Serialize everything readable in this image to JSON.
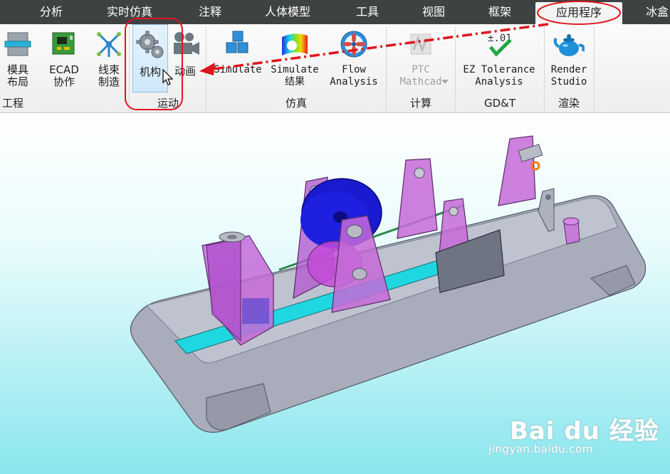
{
  "menu": {
    "tabs": [
      {
        "label": "分析",
        "active": false
      },
      {
        "label": "实时仿真",
        "active": false
      },
      {
        "label": "注释",
        "active": false
      },
      {
        "label": "人体模型",
        "active": false
      },
      {
        "label": "工具",
        "active": false
      },
      {
        "label": "视图",
        "active": false
      },
      {
        "label": "框架",
        "active": false
      },
      {
        "label": "应用程序",
        "active": true
      },
      {
        "label": "冰盒",
        "active": false
      }
    ]
  },
  "ribbon": {
    "buttons": {
      "mold_layout": "模具\n布局",
      "ecad_collab": "ECAD\n协作",
      "harness_mfg": "线束\n制造",
      "mechanism": "机构",
      "animation": "动画",
      "simulate": "Simulate",
      "simulate_results": "Simulate\n结果",
      "flow_analysis": "Flow\nAnalysis",
      "ptc_mathcad": "PTC\nMathcad",
      "ez_tolerance": "EZ Tolerance\nAnalysis",
      "render_studio": "Render\nStudio"
    },
    "groups": {
      "engineering": "工程",
      "motion": "运动",
      "simulation": "仿真",
      "calculation": "计算",
      "gdt": "GD&T",
      "render": "渲染"
    },
    "ez_icon_text": "±.01"
  },
  "annotation": {
    "color": "#e0161e"
  },
  "watermark": {
    "logo": "Bai du 经验",
    "url": "jingyan.baidu.com"
  },
  "colors": {
    "tab_bar": "#3f4243",
    "viewport_top": "#ffffff",
    "viewport_bottom": "#8ae6ee",
    "part_magenta": "#c060d8",
    "gear_blue": "#1a1ad0",
    "belt_cyan": "#18d8e0"
  }
}
